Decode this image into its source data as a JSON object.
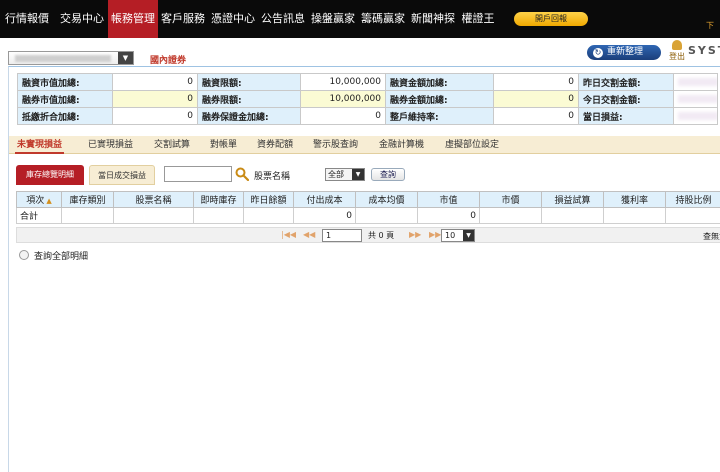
{
  "nav": {
    "items": [
      "行情報價",
      "交易中心",
      "帳務管理",
      "客戶服務",
      "憑證中心",
      "公告訊息",
      "操盤贏家",
      "籌碼贏家",
      "新聞神探",
      "權證王"
    ],
    "active_index": 2,
    "pill_label": "開戶回報",
    "corner_text": "下"
  },
  "subbar": {
    "domestic_label": "國內證券",
    "refresh_label": "重新整理",
    "logout_label": "登出",
    "brand": "SYST"
  },
  "summary": {
    "rows": [
      [
        {
          "label": "融資市值加總:",
          "value": "0",
          "highlight": false
        },
        {
          "label": "融資限額:",
          "value": "10,000,000",
          "highlight": false
        },
        {
          "label": "融資金額加總:",
          "value": "0",
          "highlight": false
        },
        {
          "label": "昨日交割金額:",
          "value": "",
          "highlight": false
        }
      ],
      [
        {
          "label": "融券市值加總:",
          "value": "0",
          "highlight": true
        },
        {
          "label": "融券限額:",
          "value": "10,000,000",
          "highlight": true
        },
        {
          "label": "融券金額加總:",
          "value": "0",
          "highlight": true
        },
        {
          "label": "今日交割金額:",
          "value": "",
          "highlight": true
        }
      ],
      [
        {
          "label": "抵繳折合加總:",
          "value": "0",
          "highlight": false
        },
        {
          "label": "融券保證金加總:",
          "value": "0",
          "highlight": false
        },
        {
          "label": "整戶維持率:",
          "value": "0",
          "highlight": false
        },
        {
          "label": "當日損益:",
          "value": "",
          "highlight": false
        }
      ]
    ]
  },
  "tabs": [
    "未實現損益",
    "已實現損益",
    "交割試算",
    "對帳單",
    "資券配額",
    "警示股查詢",
    "金融計算機",
    "虛擬部位設定"
  ],
  "filter": {
    "inventory_tab": "庫存總覽明細",
    "today_tab": "當日成交損益",
    "stock_input_value": "",
    "stock_label": "股票名稱",
    "type_select": "全部",
    "query_label": "查詢"
  },
  "grid": {
    "headers": [
      "項次",
      "庫存類別",
      "股票名稱",
      "即時庫存",
      "昨日餘額",
      "付出成本",
      "成本均價",
      "市值",
      "市價",
      "損益試算",
      "獲利率",
      "持股比例"
    ],
    "sort_indicator": "▲",
    "total_row": [
      "合計",
      "",
      "",
      "",
      "",
      "0",
      "",
      "0",
      "",
      "",
      "",
      ""
    ]
  },
  "pager": {
    "page_value": "1",
    "total_text": "共 0 頁",
    "page_size": "10",
    "status": "查無資"
  },
  "detail_checkbox_label": "查詢全部明細"
}
